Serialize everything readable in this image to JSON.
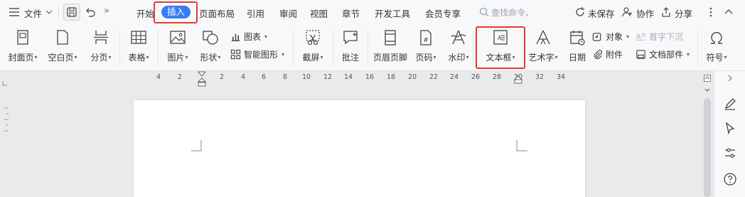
{
  "menubar": {
    "file_menu": "文件",
    "tabs": [
      "开始",
      "插入",
      "页面布局",
      "引用",
      "审阅",
      "视图",
      "章节",
      "开发工具",
      "会员专享"
    ],
    "active_tab": "插入",
    "search_placeholder": "查找命令、",
    "unsaved": "未保存",
    "collaborate": "协作",
    "share": "分享"
  },
  "ribbon": {
    "cover_page": "封面页",
    "blank_page": "空白页",
    "page_break": "分页",
    "table": "表格",
    "picture": "图片",
    "shape": "形状",
    "chart": "图表",
    "smart_shape": "智能图形",
    "screenshot": "截屏",
    "comment": "批注",
    "header_footer": "页眉页脚",
    "page_number": "页码",
    "watermark": "水印",
    "text_box": "文本框",
    "word_art": "艺术字",
    "date": "日期",
    "object": "对象",
    "attachment": "附件",
    "drop_cap": "首字下沉",
    "doc_parts": "文档部件",
    "symbol": "符号"
  },
  "ruler": {
    "ticks": [
      "4",
      "2",
      "2",
      "4",
      "6",
      "8",
      "10",
      "12",
      "14",
      "16",
      "18",
      "20",
      "22",
      "24",
      "26",
      "28",
      "30",
      "32",
      "34"
    ]
  },
  "colors": {
    "accent": "#3a7cf5",
    "highlight": "#e53935"
  }
}
